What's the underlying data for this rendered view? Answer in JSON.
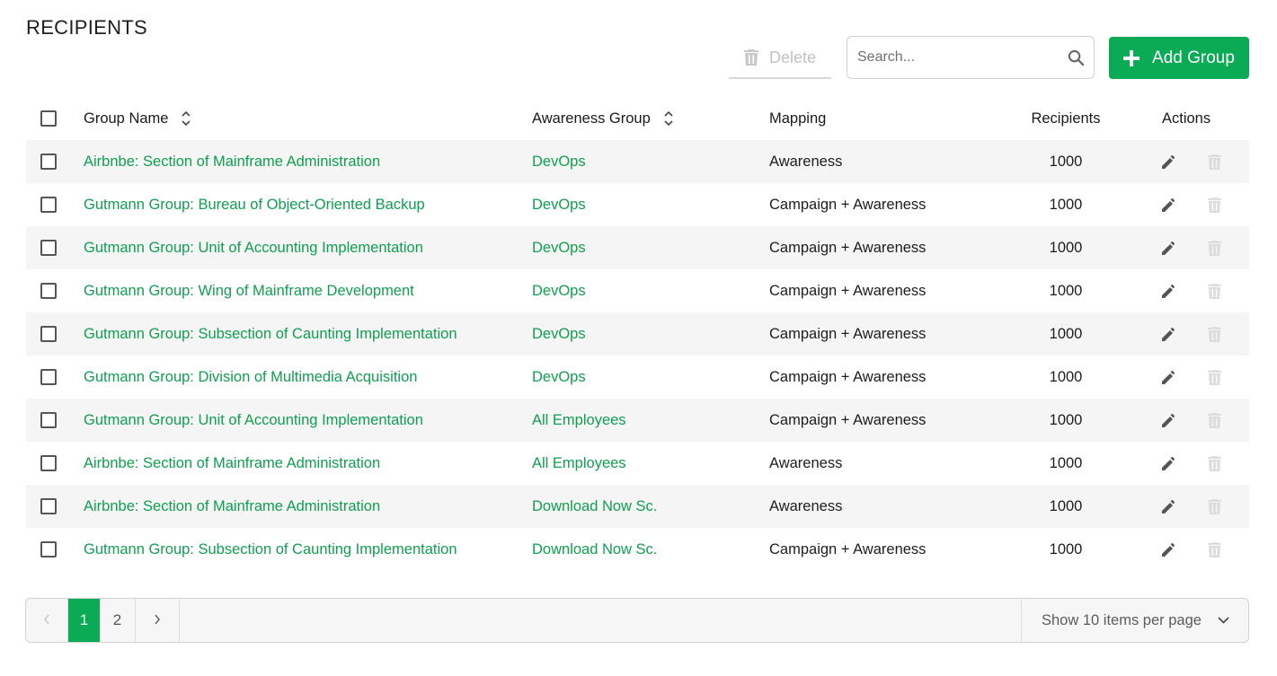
{
  "page": {
    "title": "RECIPIENTS"
  },
  "toolbar": {
    "delete_label": "Delete",
    "search_placeholder": "Search...",
    "search_value": "",
    "add_label": "Add Group"
  },
  "colors": {
    "accent": "#0bab55",
    "link": "#0f9f4f",
    "disabled": "#c2c2c2"
  },
  "table": {
    "columns": [
      "Group Name",
      "Awareness Group",
      "Mapping",
      "Recipients",
      "Actions"
    ],
    "rows": [
      {
        "name": "Airbnbe: Section of Mainframe Administration",
        "awareness": "DevOps",
        "mapping": "Awareness",
        "recipients": "1000"
      },
      {
        "name": "Gutmann Group: Bureau of Object-Oriented Backup",
        "awareness": "DevOps",
        "mapping": "Campaign + Awareness",
        "recipients": "1000"
      },
      {
        "name": "Gutmann Group: Unit of Accounting Implementation",
        "awareness": "DevOps",
        "mapping": "Campaign + Awareness",
        "recipients": "1000"
      },
      {
        "name": "Gutmann Group: Wing of Mainframe Development",
        "awareness": "DevOps",
        "mapping": "Campaign + Awareness",
        "recipients": "1000"
      },
      {
        "name": "Gutmann Group: Subsection of Caunting Implementation",
        "awareness": "DevOps",
        "mapping": "Campaign + Awareness",
        "recipients": "1000"
      },
      {
        "name": "Gutmann Group: Division of Multimedia Acquisition",
        "awareness": "DevOps",
        "mapping": "Campaign + Awareness",
        "recipients": "1000"
      },
      {
        "name": "Gutmann Group: Unit of Accounting Implementation",
        "awareness": "All Employees",
        "mapping": "Campaign + Awareness",
        "recipients": "1000"
      },
      {
        "name": "Airbnbe: Section of Mainframe Administration",
        "awareness": "All Employees",
        "mapping": "Awareness",
        "recipients": "1000"
      },
      {
        "name": "Airbnbe: Section of Mainframe Administration",
        "awareness": "Download Now Sc.",
        "mapping": "Awareness",
        "recipients": "1000"
      },
      {
        "name": "Gutmann Group: Subsection of Caunting Implementation",
        "awareness": "Download Now Sc.",
        "mapping": "Campaign + Awareness",
        "recipients": "1000"
      }
    ]
  },
  "pagination": {
    "prev_icon": "chevron-left-icon",
    "pages": [
      "1",
      "2"
    ],
    "current_page": "1",
    "next_icon": "chevron-right-icon",
    "per_page_label": "Show 10 items per page"
  },
  "icons": {
    "delete": "trash-icon",
    "search": "search-icon",
    "add": "plus-icon",
    "sort": "sort-icon",
    "edit": "pencil-icon",
    "row_delete": "trash-icon",
    "dropdown": "chevron-down-icon"
  }
}
